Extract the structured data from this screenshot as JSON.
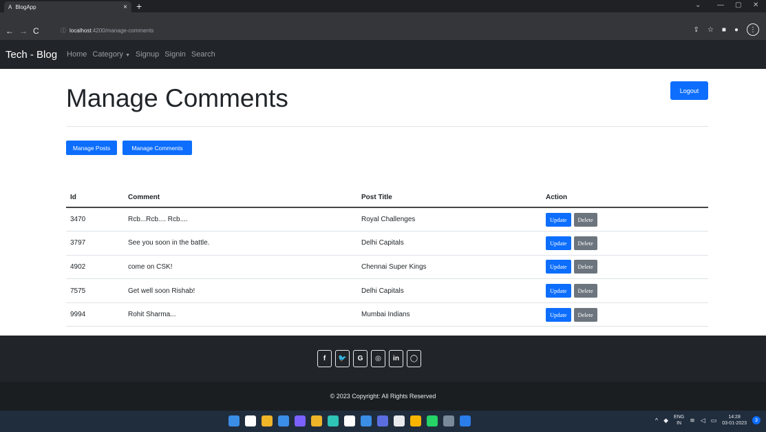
{
  "browser": {
    "tab_favicon": "A",
    "tab_title": "BlogApp",
    "tab_close": "×",
    "new_tab": "+",
    "url_host": "localhost",
    "url_path": ":4200/manage-comments",
    "window_controls": [
      "⌄",
      "—",
      "▢",
      "✕"
    ]
  },
  "navbar": {
    "brand": "Tech - Blog",
    "links": [
      "Home",
      "Category",
      "Signup",
      "Signin",
      "Search"
    ]
  },
  "page": {
    "title": "Manage Comments",
    "logout_label": "Logout",
    "manage_posts_label": "Manage Posts",
    "manage_comments_label": "Manage Comments"
  },
  "table": {
    "headers": [
      "Id",
      "Comment",
      "Post Title",
      "Action"
    ],
    "update_label": "Update",
    "delete_label": "Delete",
    "rows": [
      {
        "id": "3470",
        "comment": "Rcb...Rcb.... Rcb....",
        "post": "Royal Challenges"
      },
      {
        "id": "3797",
        "comment": "See you soon in the battle.",
        "post": "Delhi Capitals"
      },
      {
        "id": "4902",
        "comment": "come on CSK!",
        "post": "Chennai Super Kings"
      },
      {
        "id": "7575",
        "comment": "Get well soon Rishab!",
        "post": "Delhi Capitals"
      },
      {
        "id": "9994",
        "comment": "Rohit Sharma...",
        "post": "Mumbai Indians"
      }
    ]
  },
  "footer": {
    "social": [
      "f",
      "🐦",
      "G",
      "◎",
      "in",
      "◯"
    ],
    "copyright": "© 2023 Copyright: All Rights Reserved"
  },
  "taskbar": {
    "lang_top": "ENG",
    "lang_bottom": "IN",
    "time": "14:28",
    "date": "03-01-2023",
    "notification_count": "3",
    "icon_colors": [
      "#3a8ee6",
      "#ffffff",
      "#f0b429",
      "#3a8ee6",
      "#7b61ff",
      "#f0b429",
      "#2ec4b6",
      "#ffffff",
      "#3a8ee6",
      "#5b6ee1",
      "#e8eaed",
      "#f7b500",
      "#25d366",
      "#7a8a9a",
      "#2b7de9"
    ]
  },
  "colors": {
    "primary": "#0d6efd",
    "secondary": "#6c757d",
    "navbar": "#212529"
  }
}
